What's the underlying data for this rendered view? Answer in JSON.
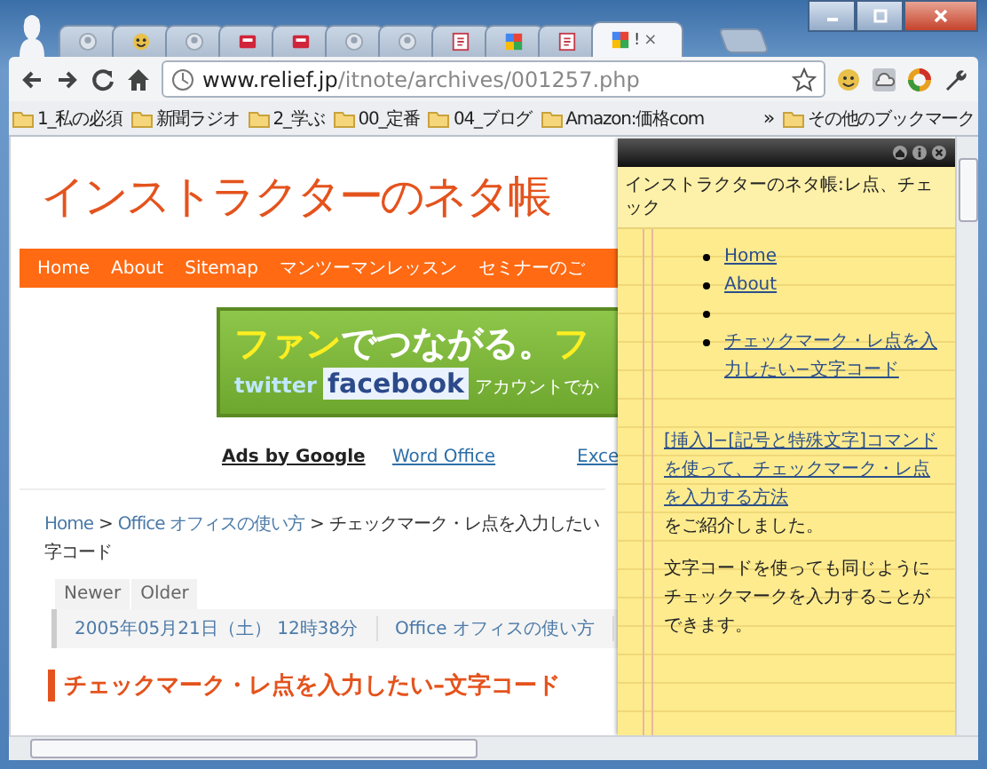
{
  "tabs": [
    {
      "kind": "person",
      "selected": false
    },
    {
      "kind": "smiley",
      "selected": false
    },
    {
      "kind": "person",
      "selected": false
    },
    {
      "kind": "red",
      "selected": false
    },
    {
      "kind": "red",
      "selected": false
    },
    {
      "kind": "person",
      "selected": false
    },
    {
      "kind": "person",
      "selected": false
    },
    {
      "kind": "page",
      "selected": false
    },
    {
      "kind": "google",
      "selected": false
    },
    {
      "kind": "page",
      "selected": false
    },
    {
      "kind": "google",
      "selected": true,
      "title": "!",
      "close": "×"
    }
  ],
  "address": {
    "host": "www.relief.jp",
    "path": "/itnote/archives/001257.php"
  },
  "bookmarks": [
    {
      "label": "1_私の必須"
    },
    {
      "label": "新聞ラジオ"
    },
    {
      "label": "2_学ぶ"
    },
    {
      "label": "00_定番"
    },
    {
      "label": "04_ブログ"
    },
    {
      "label": "Amazon:価格com"
    }
  ],
  "bookmarks_more": "»",
  "other_bookmarks": "その他のブックマーク",
  "page": {
    "site_title": "インストラクターのネタ帳",
    "nav": [
      "Home",
      "About",
      "Sitemap",
      "マンツーマンレッスン",
      "セミナーのご"
    ],
    "banner": {
      "line_1": [
        "ファン",
        "でつながる。",
        "フ"
      ],
      "twitter": "twitter",
      "facebook": "facebook",
      "line_2_tail": "アカウントでか"
    },
    "ads": [
      {
        "kind": "label",
        "text": "Ads by Google"
      },
      {
        "kind": "link",
        "text": "Word Office"
      },
      {
        "kind": "link",
        "text": "Exce"
      }
    ],
    "breadcrumb": {
      "home": "Home",
      "sep_1": ">",
      "category": "Office オフィスの使い方",
      "sep_2": ">",
      "current": "チェックマーク・レ点を入力したい",
      "current_line_2": "字コード"
    },
    "pager": [
      "Newer",
      "Older"
    ],
    "meta": [
      "2005年05月21日（土） 12時38分",
      "Office オフィスの使い方"
    ],
    "heading": "チェックマーク・レ点を入力したい–文字コード"
  },
  "panel": {
    "title": "インストラクターのネタ帳:レ点、チェック",
    "links": [
      {
        "kind": "link",
        "text": "Home"
      },
      {
        "kind": "link",
        "text": "About"
      },
      {
        "kind": "blank"
      },
      {
        "kind": "link",
        "text": "チェックマーク・レ点を入力したい−文字コード"
      }
    ],
    "paragraphs": [
      {
        "link": "[挿入]−[記号と特殊文字]コマンドを使って、チェックマーク・レ点を入力する方法",
        "text": "をご紹介しました。"
      },
      {
        "text": "文字コードを使っても同じようにチェックマークを入力することができます。"
      }
    ]
  }
}
